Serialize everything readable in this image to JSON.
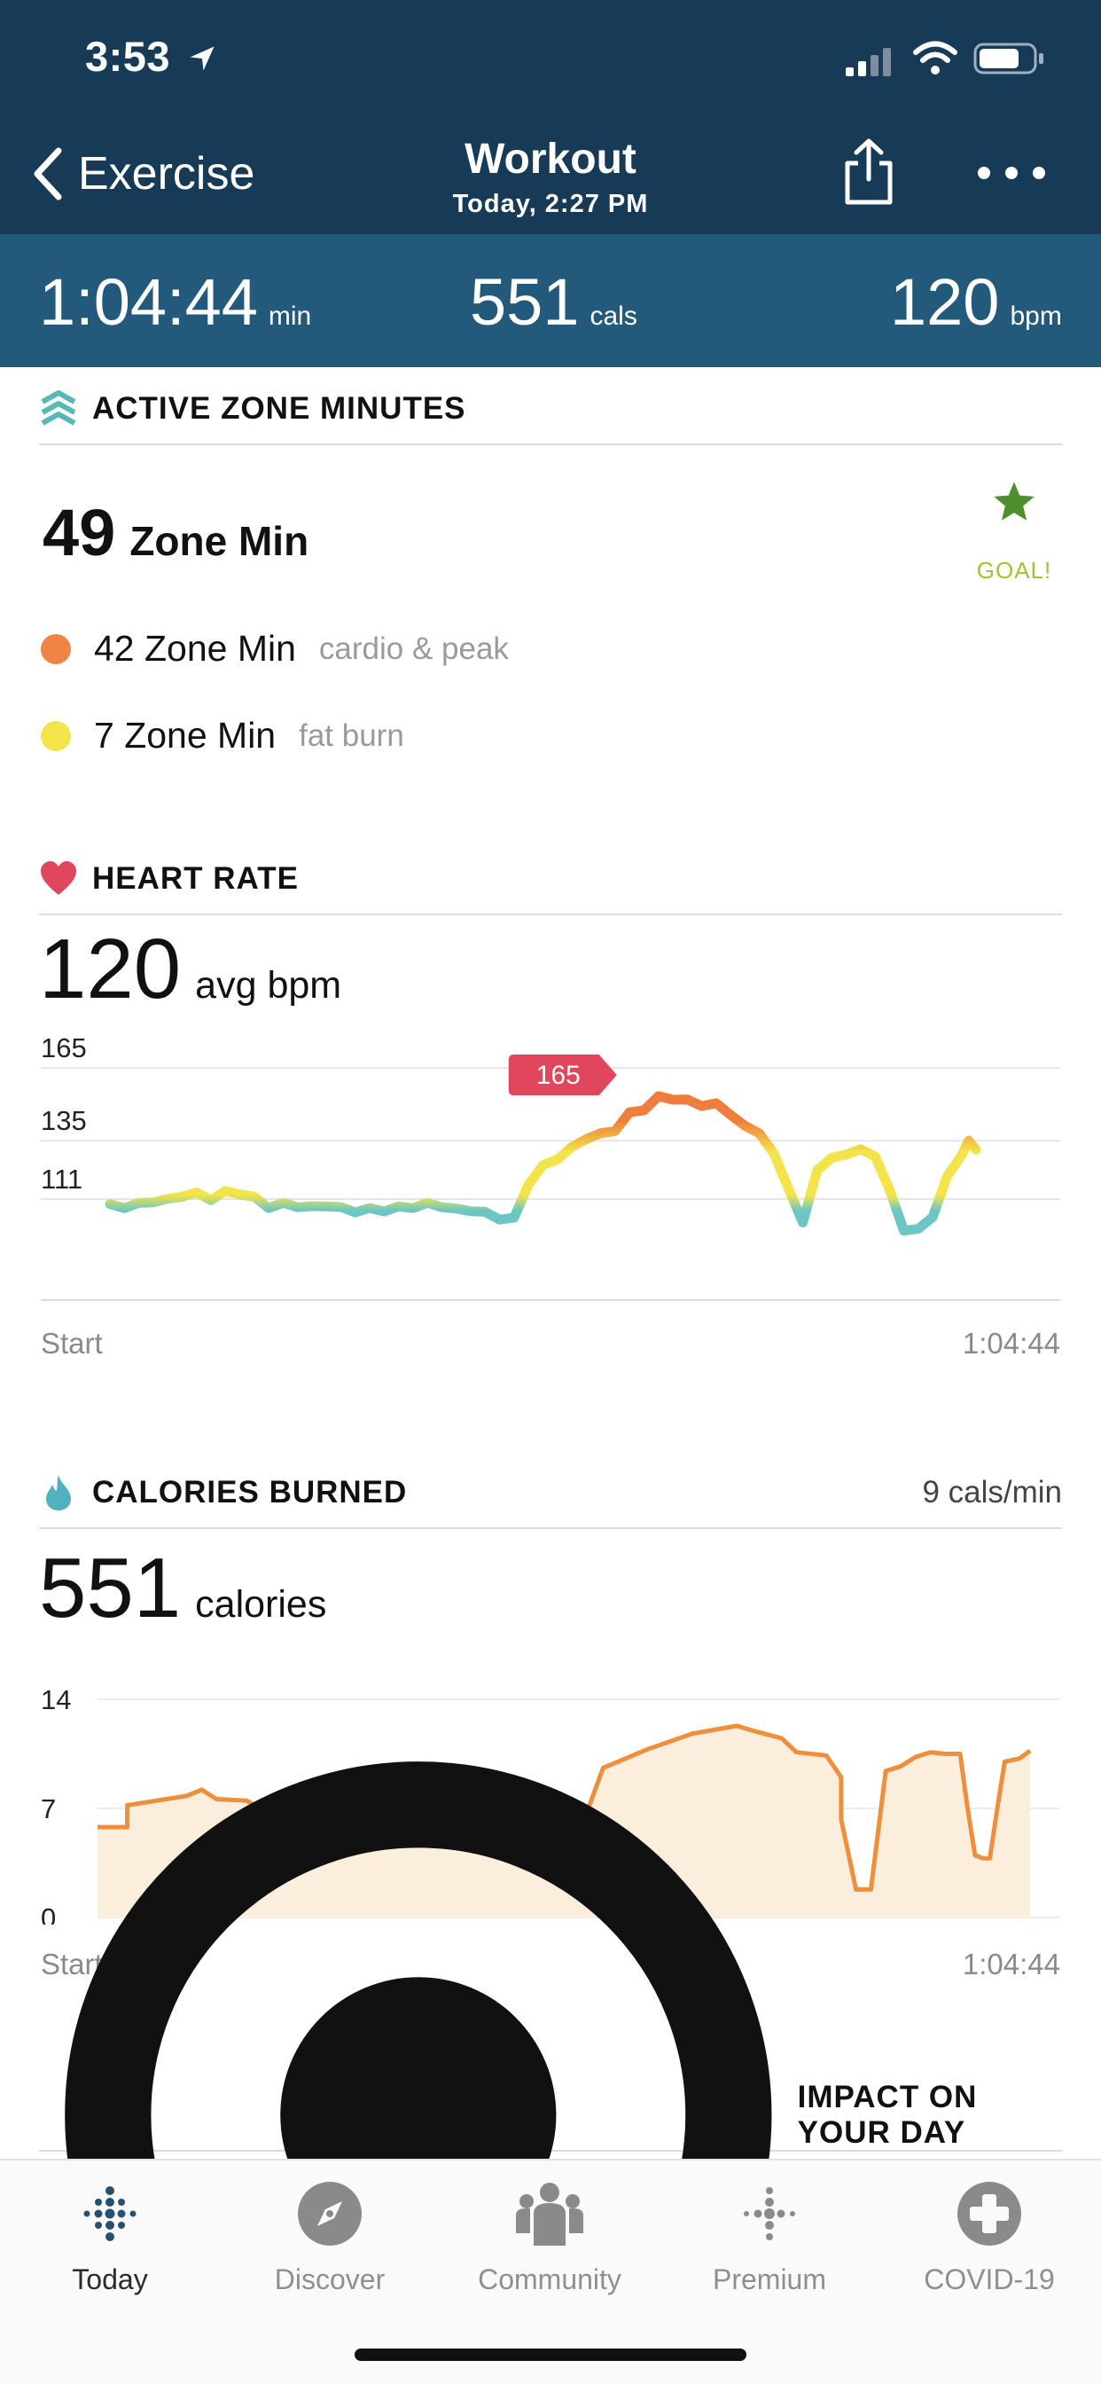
{
  "status_bar": {
    "time": "3:53"
  },
  "nav": {
    "back_label": "Exercise",
    "title": "Workout",
    "subtitle": "Today, 2:27 PM"
  },
  "summary": {
    "duration": {
      "value": "1:04:44",
      "unit": "min"
    },
    "calories": {
      "value": "551",
      "unit": "cals"
    },
    "heart_rate": {
      "value": "120",
      "unit": "bpm"
    }
  },
  "active_zone": {
    "title": "ACTIVE ZONE MINUTES",
    "total": "49",
    "total_label": "Zone Min",
    "goal_label": "GOAL!",
    "rows": [
      {
        "value": "42 Zone Min",
        "desc": "cardio & peak",
        "color": "#ef8445"
      },
      {
        "value": "7 Zone Min",
        "desc": "fat burn",
        "color": "#f2e44a"
      }
    ]
  },
  "heart_rate": {
    "title": "HEART RATE",
    "avg": "120",
    "avg_unit": "avg bpm",
    "peak_badge": "165",
    "start_label": "Start",
    "end_label": "1:04:44"
  },
  "calories": {
    "title": "CALORIES BURNED",
    "rate": "9 cals/min",
    "total": "551",
    "unit": "calories",
    "start_label": "Start",
    "end_label": "1:04:44"
  },
  "impact": {
    "title": "IMPACT ON YOUR DAY"
  },
  "tabs": [
    {
      "label": "Today",
      "icon": "today-dots-icon"
    },
    {
      "label": "Discover",
      "icon": "compass-icon"
    },
    {
      "label": "Community",
      "icon": "community-icon"
    },
    {
      "label": "Premium",
      "icon": "premium-dots-icon"
    },
    {
      "label": "COVID-19",
      "icon": "medical-cross-icon"
    }
  ],
  "colors": {
    "header": "#173a57",
    "summary": "#235a7b",
    "cardio": "#ef7d3c",
    "fat_burn": "#f2e44a",
    "below_zone": "#6cc6c4",
    "heart": "#e0475d",
    "calorie_line": "#ef8f3c",
    "calorie_fill": "#fbeedd"
  },
  "chart_data": [
    {
      "type": "line",
      "name": "heart-rate",
      "ylabel": "",
      "yticks": [
        111,
        135,
        165
      ],
      "ylim": [
        75,
        170
      ],
      "xlim": [
        0,
        64.73
      ],
      "x_labels": [
        "Start",
        "1:04:44"
      ],
      "peak_value": 165,
      "points": [
        [
          0,
          109
        ],
        [
          1,
          108
        ],
        [
          2,
          108
        ],
        [
          3,
          110
        ],
        [
          4,
          110
        ],
        [
          5,
          112
        ],
        [
          6,
          113
        ],
        [
          7,
          112
        ],
        [
          8,
          114
        ],
        [
          9,
          114
        ],
        [
          10,
          112
        ],
        [
          11,
          108
        ],
        [
          12,
          108
        ],
        [
          13,
          108
        ],
        [
          14,
          107
        ],
        [
          15,
          108
        ],
        [
          16,
          107
        ],
        [
          17,
          107
        ],
        [
          18,
          107
        ],
        [
          19,
          107
        ],
        [
          20,
          108
        ],
        [
          21,
          108
        ],
        [
          22,
          108
        ],
        [
          23,
          108
        ],
        [
          24,
          106
        ],
        [
          25,
          106
        ],
        [
          26,
          105
        ],
        [
          27,
          104
        ],
        [
          28,
          103
        ],
        [
          29,
          118
        ],
        [
          30,
          125
        ],
        [
          31,
          128
        ],
        [
          32,
          131
        ],
        [
          33,
          136
        ],
        [
          34,
          137
        ],
        [
          35,
          139
        ],
        [
          36,
          146
        ],
        [
          37,
          149
        ],
        [
          38,
          153
        ],
        [
          39,
          153
        ],
        [
          40,
          152
        ],
        [
          41,
          150
        ],
        [
          42,
          149
        ],
        [
          43,
          146
        ],
        [
          44,
          140
        ],
        [
          45,
          138
        ],
        [
          46,
          129
        ],
        [
          47,
          117
        ],
        [
          48,
          101
        ],
        [
          49,
          124
        ],
        [
          50,
          128
        ],
        [
          51,
          130
        ],
        [
          52,
          130
        ],
        [
          53,
          129
        ],
        [
          54,
          114
        ],
        [
          55,
          98
        ],
        [
          56,
          98
        ],
        [
          57,
          105
        ],
        [
          58,
          120
        ],
        [
          59,
          130
        ],
        [
          59.5,
          135
        ],
        [
          60,
          132
        ]
      ]
    },
    {
      "type": "area",
      "name": "calories-per-minute",
      "yticks": [
        0,
        7,
        14
      ],
      "ylim": [
        0,
        14
      ],
      "xlim": [
        0,
        64.73
      ],
      "x_labels": [
        "Start",
        "1:04:44"
      ],
      "points": [
        [
          0,
          5.8
        ],
        [
          2,
          5.8
        ],
        [
          2,
          7.2
        ],
        [
          4,
          7.5
        ],
        [
          6,
          7.8
        ],
        [
          7,
          8.2
        ],
        [
          8,
          7.6
        ],
        [
          10,
          7.5
        ],
        [
          11,
          7.0
        ],
        [
          12,
          7.4
        ],
        [
          13,
          7.0
        ],
        [
          14,
          7.2
        ],
        [
          16,
          7.1
        ],
        [
          18,
          7.3
        ],
        [
          20,
          7.5
        ],
        [
          23,
          7.6
        ],
        [
          27,
          7.2
        ],
        [
          31,
          7.0
        ],
        [
          32,
          5.0
        ],
        [
          33,
          5.0
        ],
        [
          33,
          7.0
        ],
        [
          34,
          9.6
        ],
        [
          35,
          10.0
        ],
        [
          37,
          10.8
        ],
        [
          40,
          11.8
        ],
        [
          43,
          12.3
        ],
        [
          44,
          12.0
        ],
        [
          46,
          11.5
        ],
        [
          47,
          10.6
        ],
        [
          49,
          10.4
        ],
        [
          50,
          9.0
        ],
        [
          50,
          6.3
        ],
        [
          51,
          1.8
        ],
        [
          52,
          1.8
        ],
        [
          53,
          9.4
        ],
        [
          54,
          9.7
        ],
        [
          55,
          10.3
        ],
        [
          56,
          10.6
        ],
        [
          57,
          10.5
        ],
        [
          58,
          10.5
        ],
        [
          58.5,
          7.0
        ],
        [
          59,
          4.0
        ],
        [
          59.5,
          3.8
        ],
        [
          60,
          3.8
        ],
        [
          60.5,
          7.0
        ],
        [
          61,
          10.0
        ],
        [
          62,
          10.2
        ],
        [
          62.7,
          10.7
        ]
      ]
    }
  ]
}
